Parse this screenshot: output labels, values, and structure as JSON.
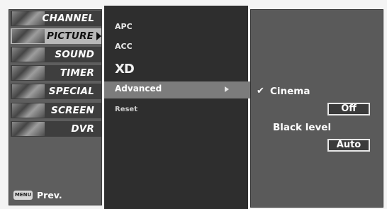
{
  "categories": [
    {
      "label": "CHANNEL",
      "icon": "channel-thumb-icon"
    },
    {
      "label": "PICTURE",
      "icon": "picture-thumb-icon",
      "active": true
    },
    {
      "label": "SOUND",
      "icon": "sound-thumb-icon"
    },
    {
      "label": "TIMER",
      "icon": "timer-thumb-icon"
    },
    {
      "label": "SPECIAL",
      "icon": "special-thumb-icon"
    },
    {
      "label": "SCREEN",
      "icon": "screen-thumb-icon"
    },
    {
      "label": "DVR",
      "icon": "dvr-thumb-icon"
    }
  ],
  "footer": {
    "menu_key": "MENU",
    "prev_label": "Prev."
  },
  "submenu": {
    "items": [
      "APC",
      "ACC",
      "XD",
      "Advanced",
      "Reset"
    ],
    "selected": "Advanced"
  },
  "options": {
    "check_mark": "✔",
    "cinema_label": "Cinema",
    "cinema_value": "Off",
    "black_level_label": "Black level",
    "black_level_value": "Auto"
  },
  "colors": {
    "panel_left": "#5e5e5e",
    "panel_mid": "#2e2e2e",
    "panel_right": "#5a5a5a",
    "highlight": "#7c7c7c",
    "active_category": "#b8b8b8"
  }
}
